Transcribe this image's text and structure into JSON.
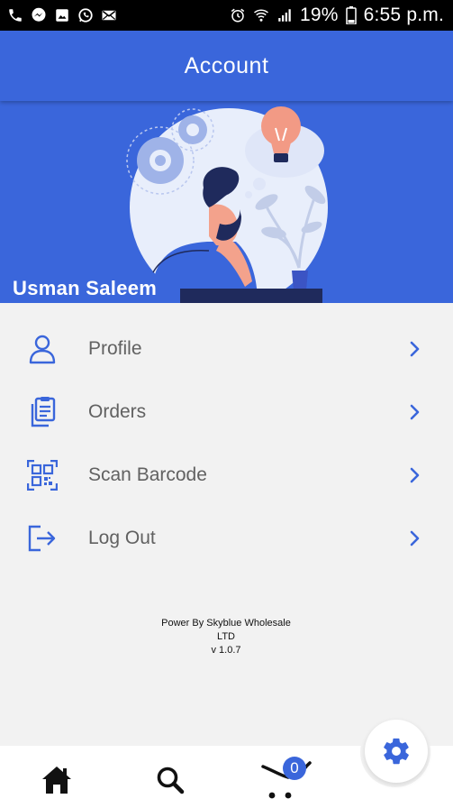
{
  "status_bar": {
    "battery_percent": "19%",
    "time": "6:55 p.m.",
    "left_icons": [
      "phone-icon",
      "messenger-icon",
      "gallery-icon",
      "whatsapp-icon",
      "mail-icon"
    ],
    "right_icons": [
      "alarm-icon",
      "wifi-icon",
      "signal-icon",
      "battery-icon"
    ]
  },
  "app_bar": {
    "title": "Account"
  },
  "profile": {
    "user_name": "Usman Saleem"
  },
  "menu": {
    "items": [
      {
        "label": "Profile",
        "icon": "person-icon"
      },
      {
        "label": "Orders",
        "icon": "clipboard-icon"
      },
      {
        "label": "Scan Barcode",
        "icon": "qr-code-icon"
      },
      {
        "label": "Log Out",
        "icon": "logout-icon"
      }
    ]
  },
  "footer": {
    "line1": "Power By Skyblue Wholesale",
    "line2": "LTD",
    "version": "v 1.0.7"
  },
  "bottom_nav": {
    "items": [
      "home-icon",
      "search-icon",
      "cart-icon"
    ],
    "cart_count": "0",
    "fab_icon": "gear-icon"
  },
  "colors": {
    "primary": "#3a66db",
    "menu_text": "#616161",
    "background": "#f2f2f2",
    "icon_blue": "#3a66db",
    "nav_icon": "#111111"
  }
}
